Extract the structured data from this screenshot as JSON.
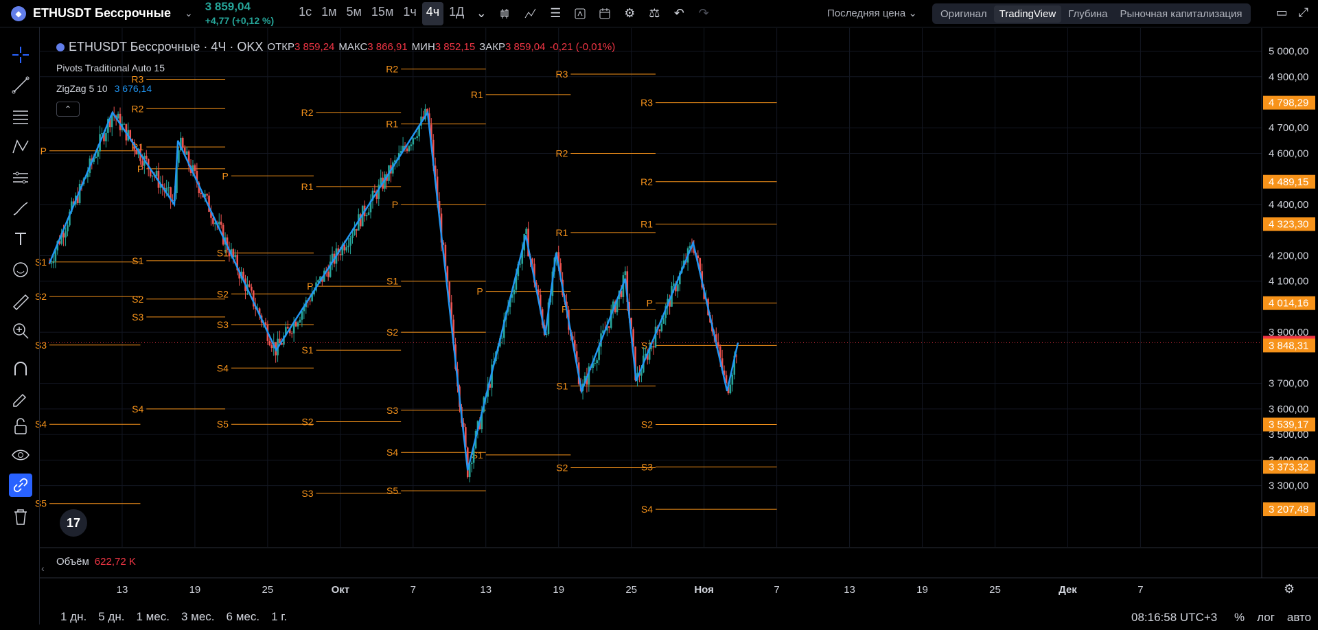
{
  "header": {
    "symbol": "ETHUSDT Бессрочные",
    "price": "3 859,04",
    "change": "+4,77 (+0,12 %)",
    "intervals": [
      "1с",
      "1м",
      "5м",
      "15м",
      "1ч",
      "4ч",
      "1Д"
    ],
    "active_interval": "4ч",
    "price_mode": "Последняя цена",
    "views": [
      "Оригинал",
      "TradingView",
      "Глубина",
      "Рыночная капитализация"
    ],
    "active_view": "TradingView"
  },
  "legend": {
    "title": "ETHUSDT Бессрочные · 4Ч · OKX",
    "open_label": "ОТКР",
    "open": "3 859,24",
    "high_label": "МАКС",
    "high": "3 866,91",
    "low_label": "МИН",
    "low": "3 852,15",
    "close_label": "ЗАКР",
    "close": "3 859,04",
    "change": "-0,21 (-0,01%)"
  },
  "indicators": {
    "pivots": "Pivots Traditional Auto 15",
    "zigzag": "ZigZag 5 10",
    "zigzag_value": "3 676,14"
  },
  "volume": {
    "label": "Объём",
    "value": "622,72 K"
  },
  "bottom": {
    "ranges": [
      "1 дн.",
      "5 дн.",
      "1 мес.",
      "3 мес.",
      "6 мес.",
      "1 г."
    ],
    "clock": "08:16:58 UTC+3",
    "percent": "%",
    "log": "лог",
    "auto": "авто"
  },
  "colors": {
    "up": "#26a69a",
    "down": "#ef5350",
    "pivot": "#f7931a",
    "zigzag": "#2196f3",
    "badge": "#f7931a",
    "last": "#f23645"
  },
  "chart_data": {
    "type": "candlestick",
    "title": "ETHUSDT Бессрочные · 4Ч · OKX",
    "y_ticks": [
      5000,
      4900,
      4700,
      4600,
      4400,
      4200,
      4100,
      3900,
      3700,
      3600,
      3500,
      3400,
      3300
    ],
    "y_tick_labels": [
      "5 000,00",
      "4 900,00",
      "4 700,00",
      "4 600,00",
      "4 400,00",
      "4 200,00",
      "4 100,00",
      "3 900,00",
      "3 700,00",
      "3 600,00",
      "3 500,00",
      "3 400,00",
      "3 300,00"
    ],
    "price_badges": [
      {
        "value": 4798.29,
        "label": "4 798,29",
        "kind": "pivot"
      },
      {
        "value": 4489.15,
        "label": "4 489,15",
        "kind": "pivot"
      },
      {
        "value": 4323.3,
        "label": "4 323,30",
        "kind": "pivot"
      },
      {
        "value": 4014.16,
        "label": "4 014,16",
        "kind": "pivot"
      },
      {
        "value": 3859.04,
        "label": "3 859,04",
        "kind": "last"
      },
      {
        "value": 3848.31,
        "label": "3 848,31",
        "kind": "pivot"
      },
      {
        "value": 3539.17,
        "label": "3 539,17",
        "kind": "pivot"
      },
      {
        "value": 3373.32,
        "label": "3 373,32",
        "kind": "pivot"
      },
      {
        "value": 3207.48,
        "label": "3 207,48",
        "kind": "pivot"
      }
    ],
    "x_labels": [
      "13",
      "19",
      "25",
      "Окт",
      "7",
      "13",
      "19",
      "25",
      "Ноя",
      "7",
      "13",
      "19",
      "25",
      "Дек",
      "7"
    ],
    "x_label_days": [
      13,
      19,
      25,
      31,
      37,
      43,
      49,
      55,
      61,
      67,
      73,
      79,
      85,
      91,
      97
    ],
    "bold_x_labels": [
      "Окт",
      "Ноя",
      "Дек"
    ],
    "zigzag": [
      {
        "d": 7.0,
        "p": 4170
      },
      {
        "d": 12.2,
        "p": 4760
      },
      {
        "d": 17.3,
        "p": 4400
      },
      {
        "d": 17.6,
        "p": 4650
      },
      {
        "d": 25.7,
        "p": 3830
      },
      {
        "d": 38.2,
        "p": 4760
      },
      {
        "d": 41.5,
        "p": 3360
      },
      {
        "d": 46.3,
        "p": 4280
      },
      {
        "d": 47.9,
        "p": 3890
      },
      {
        "d": 48.8,
        "p": 4210
      },
      {
        "d": 50.9,
        "p": 3670
      },
      {
        "d": 54.5,
        "p": 4110
      },
      {
        "d": 55.4,
        "p": 3710
      },
      {
        "d": 60.1,
        "p": 4250
      },
      {
        "d": 62.9,
        "p": 3670
      },
      {
        "d": 63.8,
        "p": 3860
      }
    ],
    "pivot_periods": [
      {
        "d0": 7.0,
        "d1": 14.5,
        "levels": [
          {
            "l": "P",
            "p": 4610
          },
          {
            "l": "S1",
            "p": 4175
          },
          {
            "l": "S2",
            "p": 4040
          },
          {
            "l": "S3",
            "p": 3850
          },
          {
            "l": "S4",
            "p": 3540
          },
          {
            "l": "S5",
            "p": 3230
          }
        ]
      },
      {
        "d0": 15.0,
        "d1": 21.5,
        "levels": [
          {
            "l": "R3",
            "p": 4890
          },
          {
            "l": "R2",
            "p": 4775
          },
          {
            "l": "R1",
            "p": 4625
          },
          {
            "l": "P",
            "p": 4540
          },
          {
            "l": "S1",
            "p": 4180
          },
          {
            "l": "S2",
            "p": 4030
          },
          {
            "l": "S3",
            "p": 3960
          },
          {
            "l": "S4",
            "p": 3600
          }
        ]
      },
      {
        "d0": 22.0,
        "d1": 28.8,
        "levels": [
          {
            "l": "P",
            "p": 4512
          },
          {
            "l": "S1",
            "p": 4210
          },
          {
            "l": "S2",
            "p": 4050
          },
          {
            "l": "S3",
            "p": 3930
          },
          {
            "l": "S4",
            "p": 3760
          },
          {
            "l": "S5",
            "p": 3540
          }
        ]
      },
      {
        "d0": 29.0,
        "d1": 36.0,
        "levels": [
          {
            "l": "R2",
            "p": 4760
          },
          {
            "l": "R1",
            "p": 4470
          },
          {
            "l": "P",
            "p": 4080
          },
          {
            "l": "S1",
            "p": 3830
          },
          {
            "l": "S2",
            "p": 3550
          },
          {
            "l": "S3",
            "p": 3270
          }
        ]
      },
      {
        "d0": 36.0,
        "d1": 43.0,
        "levels": [
          {
            "l": "R2",
            "p": 4930
          },
          {
            "l": "R1",
            "p": 4715
          },
          {
            "l": "P",
            "p": 4400
          },
          {
            "l": "S1",
            "p": 4100
          },
          {
            "l": "S2",
            "p": 3900
          },
          {
            "l": "S3",
            "p": 3595
          },
          {
            "l": "S4",
            "p": 3430
          },
          {
            "l": "S5",
            "p": 3280
          }
        ]
      },
      {
        "d0": 43.0,
        "d1": 50.0,
        "levels": [
          {
            "l": "R1",
            "p": 4830
          },
          {
            "l": "P",
            "p": 4060
          },
          {
            "l": "S1",
            "p": 3420
          }
        ]
      },
      {
        "d0": 50.0,
        "d1": 57.0,
        "levels": [
          {
            "l": "R3",
            "p": 4910
          },
          {
            "l": "R2",
            "p": 4600
          },
          {
            "l": "R1",
            "p": 4290
          },
          {
            "l": "P",
            "p": 3990
          },
          {
            "l": "S1",
            "p": 3690
          },
          {
            "l": "S2",
            "p": 3370
          }
        ]
      },
      {
        "d0": 57.0,
        "d1": 67.0,
        "levels": [
          {
            "l": "R3",
            "p": 4798.29
          },
          {
            "l": "R2",
            "p": 4489.15
          },
          {
            "l": "R1",
            "p": 4323.3
          },
          {
            "l": "P",
            "p": 4014.16
          },
          {
            "l": "S1",
            "p": 3848.31
          },
          {
            "l": "S2",
            "p": 3539.17
          },
          {
            "l": "S3",
            "p": 3373.32
          },
          {
            "l": "S4",
            "p": 3207.48
          }
        ]
      }
    ],
    "last_price": 3859.04,
    "ylim": [
      3060,
      5090
    ],
    "xlim": [
      7,
      107
    ]
  }
}
